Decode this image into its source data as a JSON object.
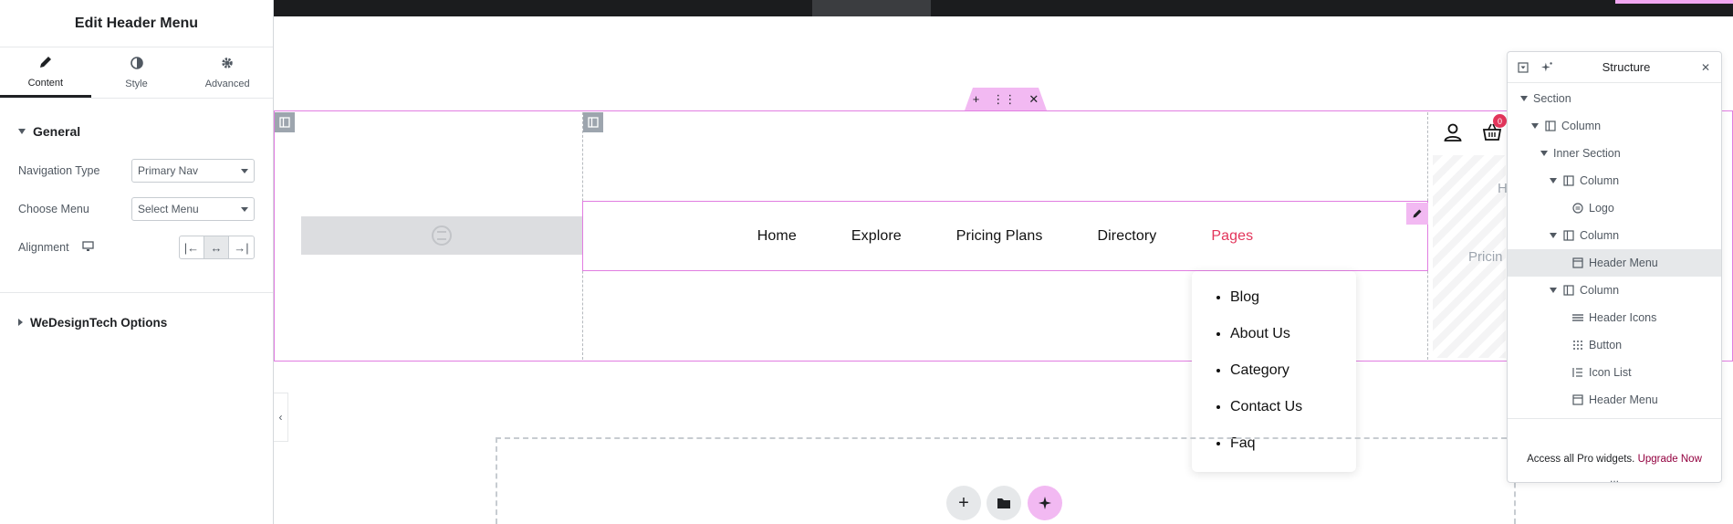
{
  "panel": {
    "title": "Edit Header Menu",
    "tabs": [
      {
        "label": "Content",
        "icon": "pencil-icon"
      },
      {
        "label": "Style",
        "icon": "contrast-icon"
      },
      {
        "label": "Advanced",
        "icon": "gear-icon"
      }
    ],
    "general": {
      "title": "General",
      "navigation_type": {
        "label": "Navigation Type",
        "value": "Primary Nav"
      },
      "choose_menu": {
        "label": "Choose Menu",
        "value": "Select Menu"
      },
      "alignment": {
        "label": "Alignment"
      }
    },
    "options_title": "WeDesignTech Options"
  },
  "canvas": {
    "menu": [
      "Home",
      "Explore",
      "Pricing Plans",
      "Directory",
      "Pages"
    ],
    "submenu": [
      "Blog",
      "About Us",
      "Category",
      "Contact Us",
      "Faq"
    ],
    "cart_badge": "0",
    "peek_texts": [
      "H",
      "Pricin"
    ]
  },
  "structure": {
    "title": "Structure",
    "nodes": [
      {
        "label": "Section"
      },
      {
        "label": "Column"
      },
      {
        "label": "Inner Section"
      },
      {
        "label": "Column"
      },
      {
        "label": "Logo"
      },
      {
        "label": "Column"
      },
      {
        "label": "Header Menu"
      },
      {
        "label": "Column"
      },
      {
        "label": "Header Icons"
      },
      {
        "label": "Button"
      },
      {
        "label": "Icon List"
      },
      {
        "label": "Header Menu"
      }
    ],
    "footer_text": "Access all Pro widgets.",
    "upgrade_link": "Upgrade Now",
    "more_dots": "..."
  },
  "colors": {
    "accent": "#e3355b",
    "editor_pink": "#e17de1",
    "upgrade": "#93003f"
  }
}
